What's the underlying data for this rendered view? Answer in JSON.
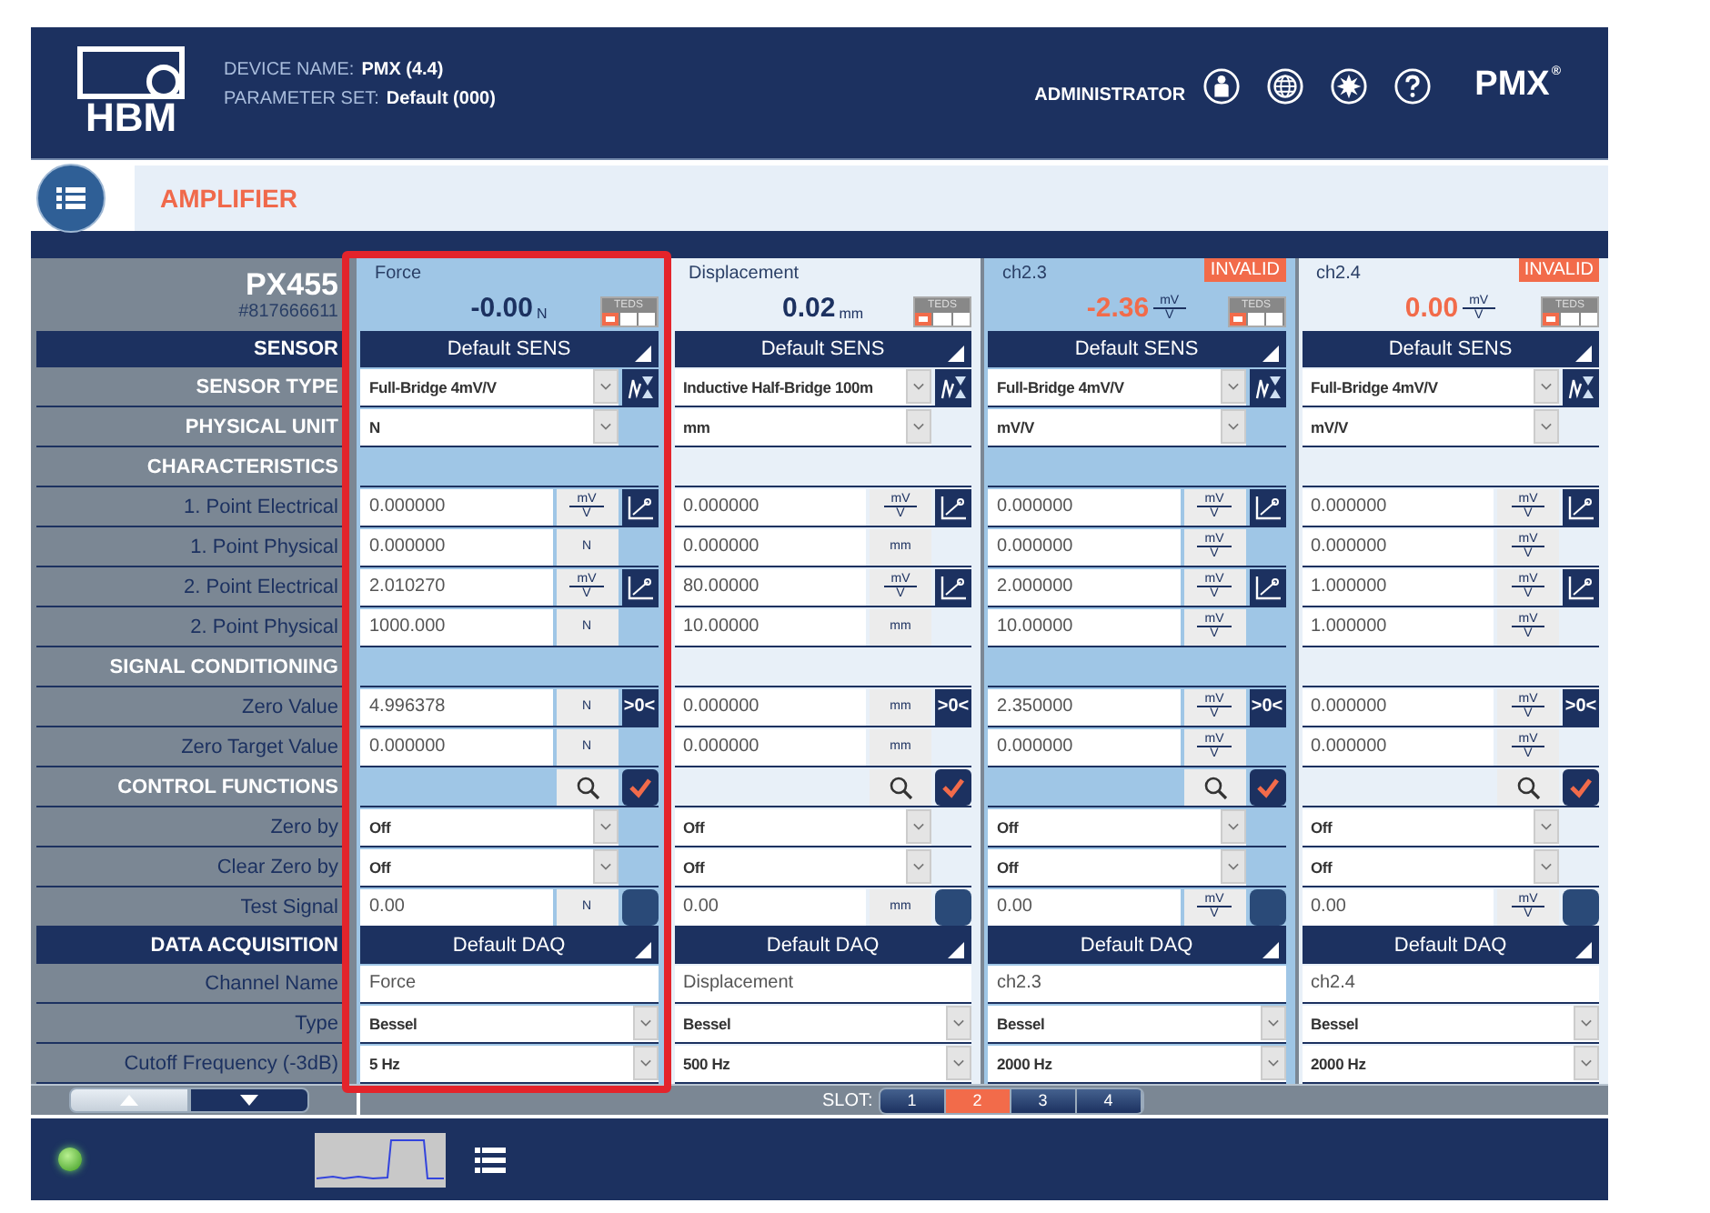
{
  "header": {
    "logo_text": "HBM",
    "device_label": "DEVICE NAME:",
    "device_value": "PMX  (4.4)",
    "parameter_label": "PARAMETER SET:",
    "parameter_value": "Default (000)",
    "user": "ADMINISTRATOR",
    "brand": "PMX",
    "brand_mark": "®"
  },
  "page": {
    "title": "AMPLIFIER"
  },
  "module": {
    "name": "PX455",
    "serial": "#817666611"
  },
  "labels": [
    {
      "kind": "bar",
      "text": "SENSOR"
    },
    {
      "kind": "group",
      "text": "SENSOR TYPE"
    },
    {
      "kind": "group",
      "text": "PHYSICAL UNIT"
    },
    {
      "kind": "group",
      "text": "CHARACTERISTICS"
    },
    {
      "kind": "item",
      "text": "1. Point Electrical"
    },
    {
      "kind": "item",
      "text": "1. Point Physical"
    },
    {
      "kind": "item",
      "text": "2. Point Electrical"
    },
    {
      "kind": "item",
      "text": "2. Point Physical"
    },
    {
      "kind": "group",
      "text": "SIGNAL CONDITIONING"
    },
    {
      "kind": "item",
      "text": "Zero Value"
    },
    {
      "kind": "item",
      "text": "Zero Target Value"
    },
    {
      "kind": "group",
      "text": "CONTROL FUNCTIONS"
    },
    {
      "kind": "item",
      "text": "Zero by"
    },
    {
      "kind": "item",
      "text": "Clear Zero by"
    },
    {
      "kind": "item",
      "text": "Test Signal"
    },
    {
      "kind": "bar",
      "text": "DATA ACQUISITION"
    },
    {
      "kind": "item",
      "text": "Channel Name"
    },
    {
      "kind": "item",
      "text": "Type"
    },
    {
      "kind": "item",
      "text": "Cutoff Frequency (-3dB)"
    }
  ],
  "channels": [
    {
      "name": "Force",
      "reading": "-0.00",
      "unit": {
        "text": "N"
      },
      "teds": "TEDS",
      "selected": true,
      "highlighted": true,
      "rows": [
        {
          "kind": "set",
          "text": "Default SENS"
        },
        {
          "kind": "select_sensor",
          "text": "Full-Bridge 4mV/V"
        },
        {
          "kind": "select",
          "text": "N"
        },
        {
          "kind": "empty"
        },
        {
          "kind": "number_scale",
          "value": "0.000000",
          "unit": {
            "num": "mV",
            "den": "V"
          }
        },
        {
          "kind": "number",
          "value": "0.000000",
          "unit": {
            "text": "N"
          }
        },
        {
          "kind": "number_scale",
          "value": "2.010270",
          "unit": {
            "num": "mV",
            "den": "V"
          }
        },
        {
          "kind": "number",
          "value": "1000.000",
          "unit": {
            "text": "N"
          }
        },
        {
          "kind": "empty"
        },
        {
          "kind": "number_zero",
          "value": "4.996378",
          "unit": {
            "text": "N"
          },
          "button_text": ">0<"
        },
        {
          "kind": "number",
          "value": "0.000000",
          "unit": {
            "text": "N"
          }
        },
        {
          "kind": "tools",
          "checked": true
        },
        {
          "kind": "select",
          "text": "Off"
        },
        {
          "kind": "select",
          "text": "Off"
        },
        {
          "kind": "number_toggle",
          "value": "0.00",
          "unit": {
            "text": "N"
          },
          "on": false
        },
        {
          "kind": "set",
          "text": "Default DAQ"
        },
        {
          "kind": "text",
          "value": "Force"
        },
        {
          "kind": "select_full",
          "text": "Bessel"
        },
        {
          "kind": "select_full",
          "text": "5 Hz"
        }
      ]
    },
    {
      "name": "Displacement",
      "reading": "0.02",
      "unit": {
        "text": "mm"
      },
      "teds": "TEDS",
      "selected": false,
      "highlighted": false,
      "rows": [
        {
          "kind": "set",
          "text": "Default SENS"
        },
        {
          "kind": "select_sensor",
          "text": "Inductive Half-Bridge 100m"
        },
        {
          "kind": "select",
          "text": "mm"
        },
        {
          "kind": "empty"
        },
        {
          "kind": "number_scale",
          "value": "0.000000",
          "unit": {
            "num": "mV",
            "den": "V"
          }
        },
        {
          "kind": "number",
          "value": "0.000000",
          "unit": {
            "text": "mm"
          }
        },
        {
          "kind": "number_scale",
          "value": "80.00000",
          "unit": {
            "num": "mV",
            "den": "V"
          }
        },
        {
          "kind": "number",
          "value": "10.00000",
          "unit": {
            "text": "mm"
          }
        },
        {
          "kind": "empty"
        },
        {
          "kind": "number_zero",
          "value": "0.000000",
          "unit": {
            "text": "mm"
          },
          "button_text": ">0<"
        },
        {
          "kind": "number",
          "value": "0.000000",
          "unit": {
            "text": "mm"
          }
        },
        {
          "kind": "tools",
          "checked": true
        },
        {
          "kind": "select",
          "text": "Off"
        },
        {
          "kind": "select",
          "text": "Off"
        },
        {
          "kind": "number_toggle",
          "value": "0.00",
          "unit": {
            "text": "mm"
          },
          "on": false
        },
        {
          "kind": "set",
          "text": "Default DAQ"
        },
        {
          "kind": "text",
          "value": "Displacement"
        },
        {
          "kind": "select_full",
          "text": "Bessel"
        },
        {
          "kind": "select_full",
          "text": "500 Hz"
        }
      ]
    },
    {
      "name": "ch2.3",
      "reading": "-2.36",
      "unit": {
        "num": "mV",
        "den": "V"
      },
      "teds": "TEDS",
      "badge": "INVALID",
      "selected": true,
      "highlighted": false,
      "rows": [
        {
          "kind": "set",
          "text": "Default SENS"
        },
        {
          "kind": "select_sensor",
          "text": "Full-Bridge 4mV/V"
        },
        {
          "kind": "select",
          "text": "mV/V"
        },
        {
          "kind": "empty"
        },
        {
          "kind": "number_scale",
          "value": "0.000000",
          "unit": {
            "num": "mV",
            "den": "V"
          }
        },
        {
          "kind": "number",
          "value": "0.000000",
          "unit": {
            "num": "mV",
            "den": "V"
          }
        },
        {
          "kind": "number_scale",
          "value": "2.000000",
          "unit": {
            "num": "mV",
            "den": "V"
          }
        },
        {
          "kind": "number",
          "value": "10.00000",
          "unit": {
            "num": "mV",
            "den": "V"
          }
        },
        {
          "kind": "empty"
        },
        {
          "kind": "number_zero",
          "value": "2.350000",
          "unit": {
            "num": "mV",
            "den": "V"
          },
          "button_text": ">0<"
        },
        {
          "kind": "number",
          "value": "0.000000",
          "unit": {
            "num": "mV",
            "den": "V"
          }
        },
        {
          "kind": "tools",
          "checked": true
        },
        {
          "kind": "select",
          "text": "Off"
        },
        {
          "kind": "select",
          "text": "Off"
        },
        {
          "kind": "number_toggle",
          "value": "0.00",
          "unit": {
            "num": "mV",
            "den": "V"
          },
          "on": false
        },
        {
          "kind": "set",
          "text": "Default DAQ"
        },
        {
          "kind": "text",
          "value": "ch2.3"
        },
        {
          "kind": "select_full",
          "text": "Bessel"
        },
        {
          "kind": "select_full",
          "text": "2000 Hz"
        }
      ]
    },
    {
      "name": "ch2.4",
      "reading": "0.00",
      "unit": {
        "num": "mV",
        "den": "V"
      },
      "teds": "TEDS",
      "badge": "INVALID",
      "selected": false,
      "highlighted": false,
      "rows": [
        {
          "kind": "set",
          "text": "Default SENS"
        },
        {
          "kind": "select_sensor",
          "text": "Full-Bridge 4mV/V"
        },
        {
          "kind": "select",
          "text": "mV/V"
        },
        {
          "kind": "empty"
        },
        {
          "kind": "number_scale",
          "value": "0.000000",
          "unit": {
            "num": "mV",
            "den": "V"
          }
        },
        {
          "kind": "number",
          "value": "0.000000",
          "unit": {
            "num": "mV",
            "den": "V"
          }
        },
        {
          "kind": "number_scale",
          "value": "1.000000",
          "unit": {
            "num": "mV",
            "den": "V"
          }
        },
        {
          "kind": "number",
          "value": "1.000000",
          "unit": {
            "num": "mV",
            "den": "V"
          }
        },
        {
          "kind": "empty"
        },
        {
          "kind": "number_zero",
          "value": "0.000000",
          "unit": {
            "num": "mV",
            "den": "V"
          },
          "button_text": ">0<"
        },
        {
          "kind": "number",
          "value": "0.000000",
          "unit": {
            "num": "mV",
            "den": "V"
          }
        },
        {
          "kind": "tools",
          "checked": true
        },
        {
          "kind": "select",
          "text": "Off"
        },
        {
          "kind": "select",
          "text": "Off"
        },
        {
          "kind": "number_toggle",
          "value": "0.00",
          "unit": {
            "num": "mV",
            "den": "V"
          },
          "on": false
        },
        {
          "kind": "set",
          "text": "Default DAQ"
        },
        {
          "kind": "text",
          "value": "ch2.4"
        },
        {
          "kind": "select_full",
          "text": "Bessel"
        },
        {
          "kind": "select_full",
          "text": "2000 Hz"
        }
      ]
    }
  ],
  "slot_bar": {
    "label": "SLOT:",
    "slots": [
      {
        "label": "1",
        "selected": false
      },
      {
        "label": "2",
        "selected": true
      },
      {
        "label": "3",
        "selected": false
      },
      {
        "label": "4",
        "selected": false
      }
    ]
  },
  "footer": {
    "status_ok": true
  }
}
